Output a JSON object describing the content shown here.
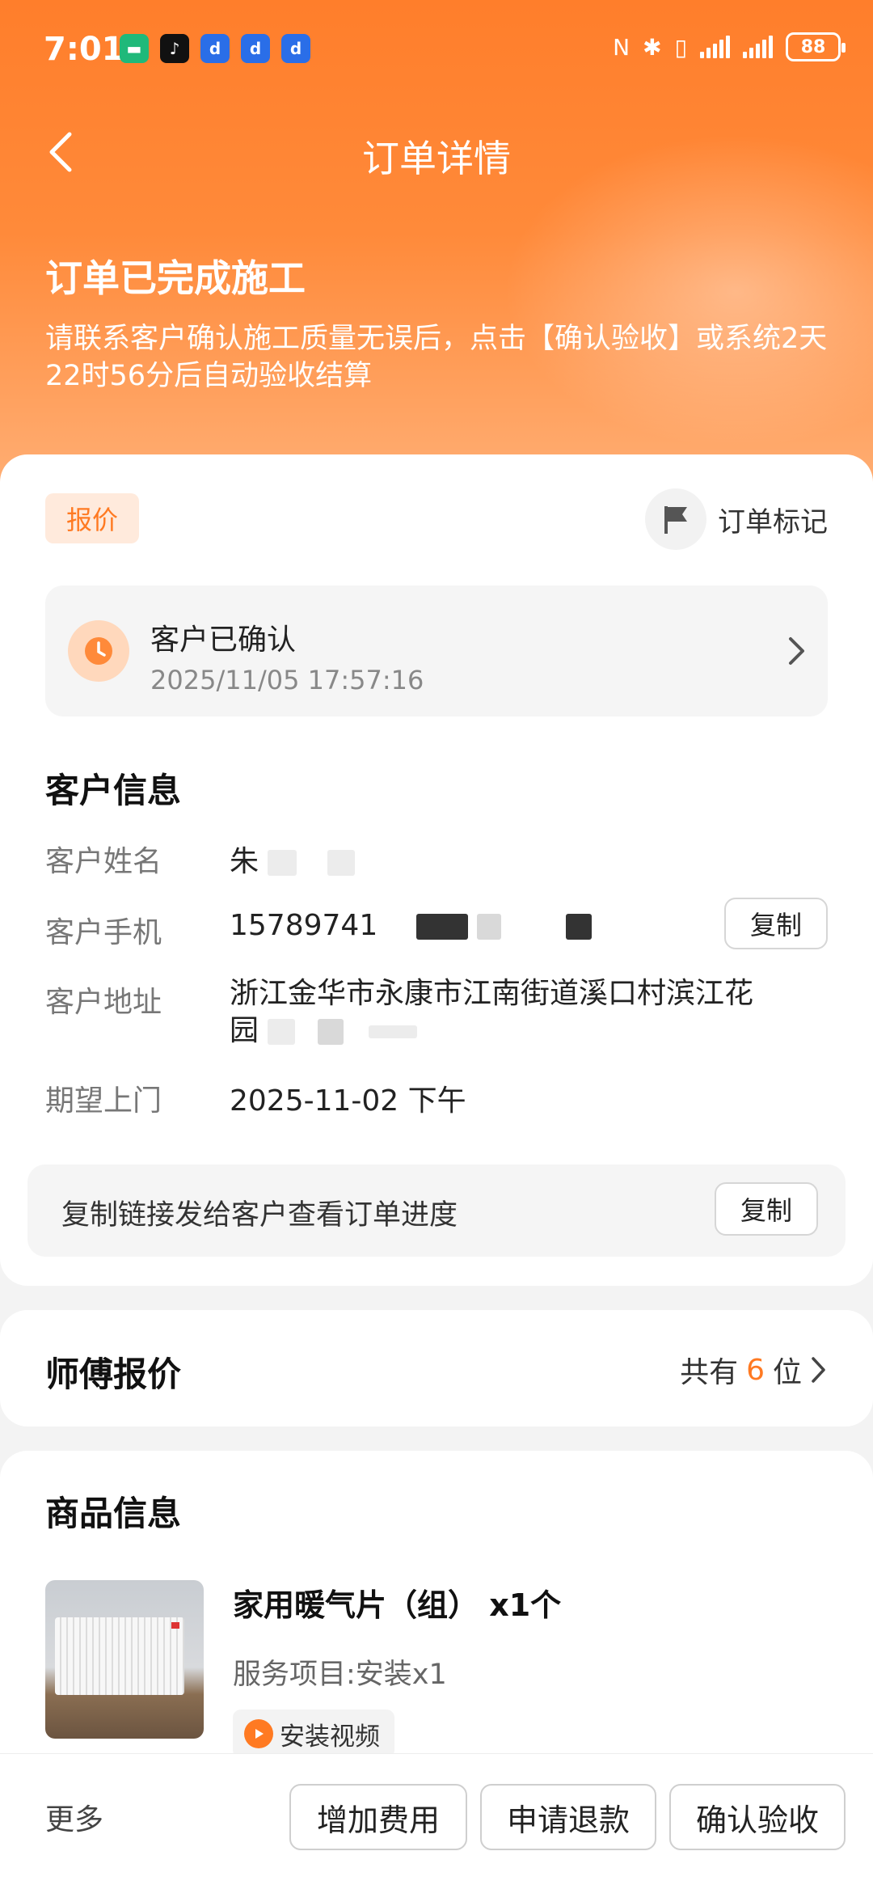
{
  "status_bar": {
    "time": "7:01",
    "battery": "88",
    "apps": [
      "green-app",
      "tiktok",
      "blue-app",
      "blue-app",
      "blue-app"
    ]
  },
  "header": {
    "title": "订单详情"
  },
  "hero": {
    "status_title": "订单已完成施工",
    "description": "请联系客户确认施工质量无误后，点击【确认验收】或系统2天22时56分后自动验收结算"
  },
  "order": {
    "tag": "报价",
    "mark_label": "订单标记",
    "confirm_title": "客户已确认",
    "confirm_time": "2025/11/05 17:57:16"
  },
  "customer": {
    "section_title": "客户信息",
    "name_label": "客户姓名",
    "name_value": "朱",
    "phone_label": "客户手机",
    "phone_value": "15789741",
    "copy_label": "复制",
    "address_label": "客户地址",
    "address_line1": "浙江金华市永康市江南街道溪口村滨江花",
    "address_line2": "园",
    "visit_label": "期望上门",
    "visit_value": "2025-11-02 下午",
    "link_text": "复制链接发给客户查看订单进度",
    "link_copy_label": "复制"
  },
  "quote": {
    "title": "师傅报价",
    "count_prefix": "共有",
    "count": "6",
    "count_suffix": "位"
  },
  "goods": {
    "section_title": "商品信息",
    "name": "家用暖气片（组） x1个",
    "service": "服务项目:安装x1",
    "video_label": "安装视频"
  },
  "bottom_bar": {
    "more_label": "更多",
    "add_fee_label": "增加费用",
    "refund_label": "申请退款",
    "accept_label": "确认验收"
  },
  "colors": {
    "accent": "#ff7a22",
    "hero_top": "#ff7e2b"
  }
}
